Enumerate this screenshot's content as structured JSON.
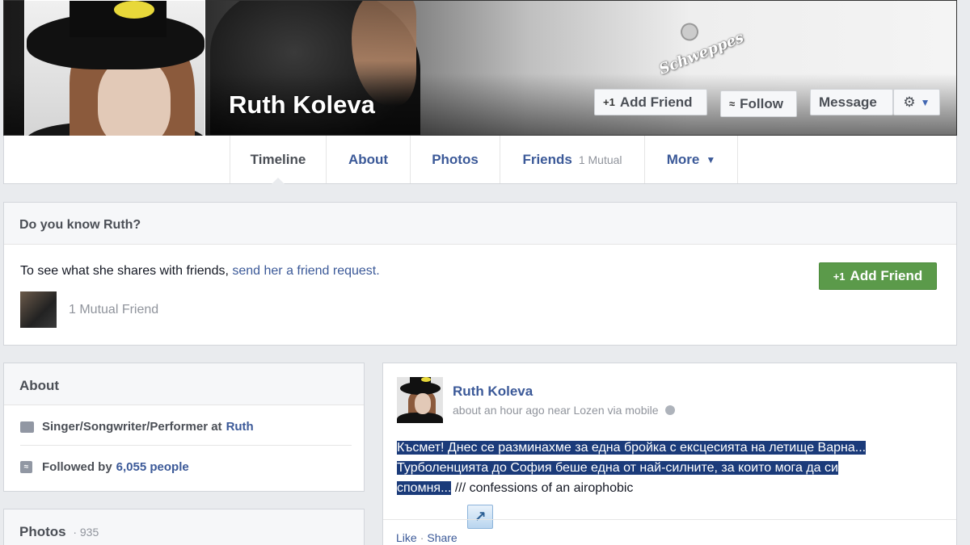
{
  "profile": {
    "name": "Ruth Koleva",
    "cover_brand": "Schweppes"
  },
  "cover_actions": {
    "add_friend": "Add Friend",
    "follow": "Follow",
    "message": "Message"
  },
  "icons": {
    "add_friend": "+1",
    "follow": "rss-icon",
    "gear": "gear-icon",
    "caret": "chevron-down-icon"
  },
  "tabs": [
    {
      "label": "Timeline",
      "active": true
    },
    {
      "label": "About"
    },
    {
      "label": "Photos"
    },
    {
      "label": "Friends",
      "sub": "1 Mutual"
    },
    {
      "label": "More"
    }
  ],
  "know": {
    "title": "Do you know Ruth?",
    "text": "To see what she shares with friends, ",
    "link": "send her a friend request.",
    "button": "Add Friend",
    "mutual": "1 Mutual Friend"
  },
  "about": {
    "title": "About",
    "work_prefix": "Singer/Songwriter/Performer at",
    "work_link": "Ruth",
    "followed_prefix": "Followed by",
    "followed_link": "6,055 people"
  },
  "photos": {
    "title": "Photos",
    "count": "· 935"
  },
  "post": {
    "author": "Ruth Koleva",
    "meta": "about an hour ago near Lozen via mobile",
    "line1": "Късмет! Днес се разминахме за една бройка с ексцесията на летище Варна...",
    "line2": "Турболенцията до София беше една от най-силните, за които мога да си",
    "line3": "спомня...",
    "line3_rest": " /// confessions of an airophobic",
    "like": "Like",
    "share": "Share"
  },
  "colors": {
    "link": "#3b5998",
    "green_button": "#5b9a4a",
    "page_bg": "#e9ebee",
    "selection": "#1b3b7a"
  }
}
